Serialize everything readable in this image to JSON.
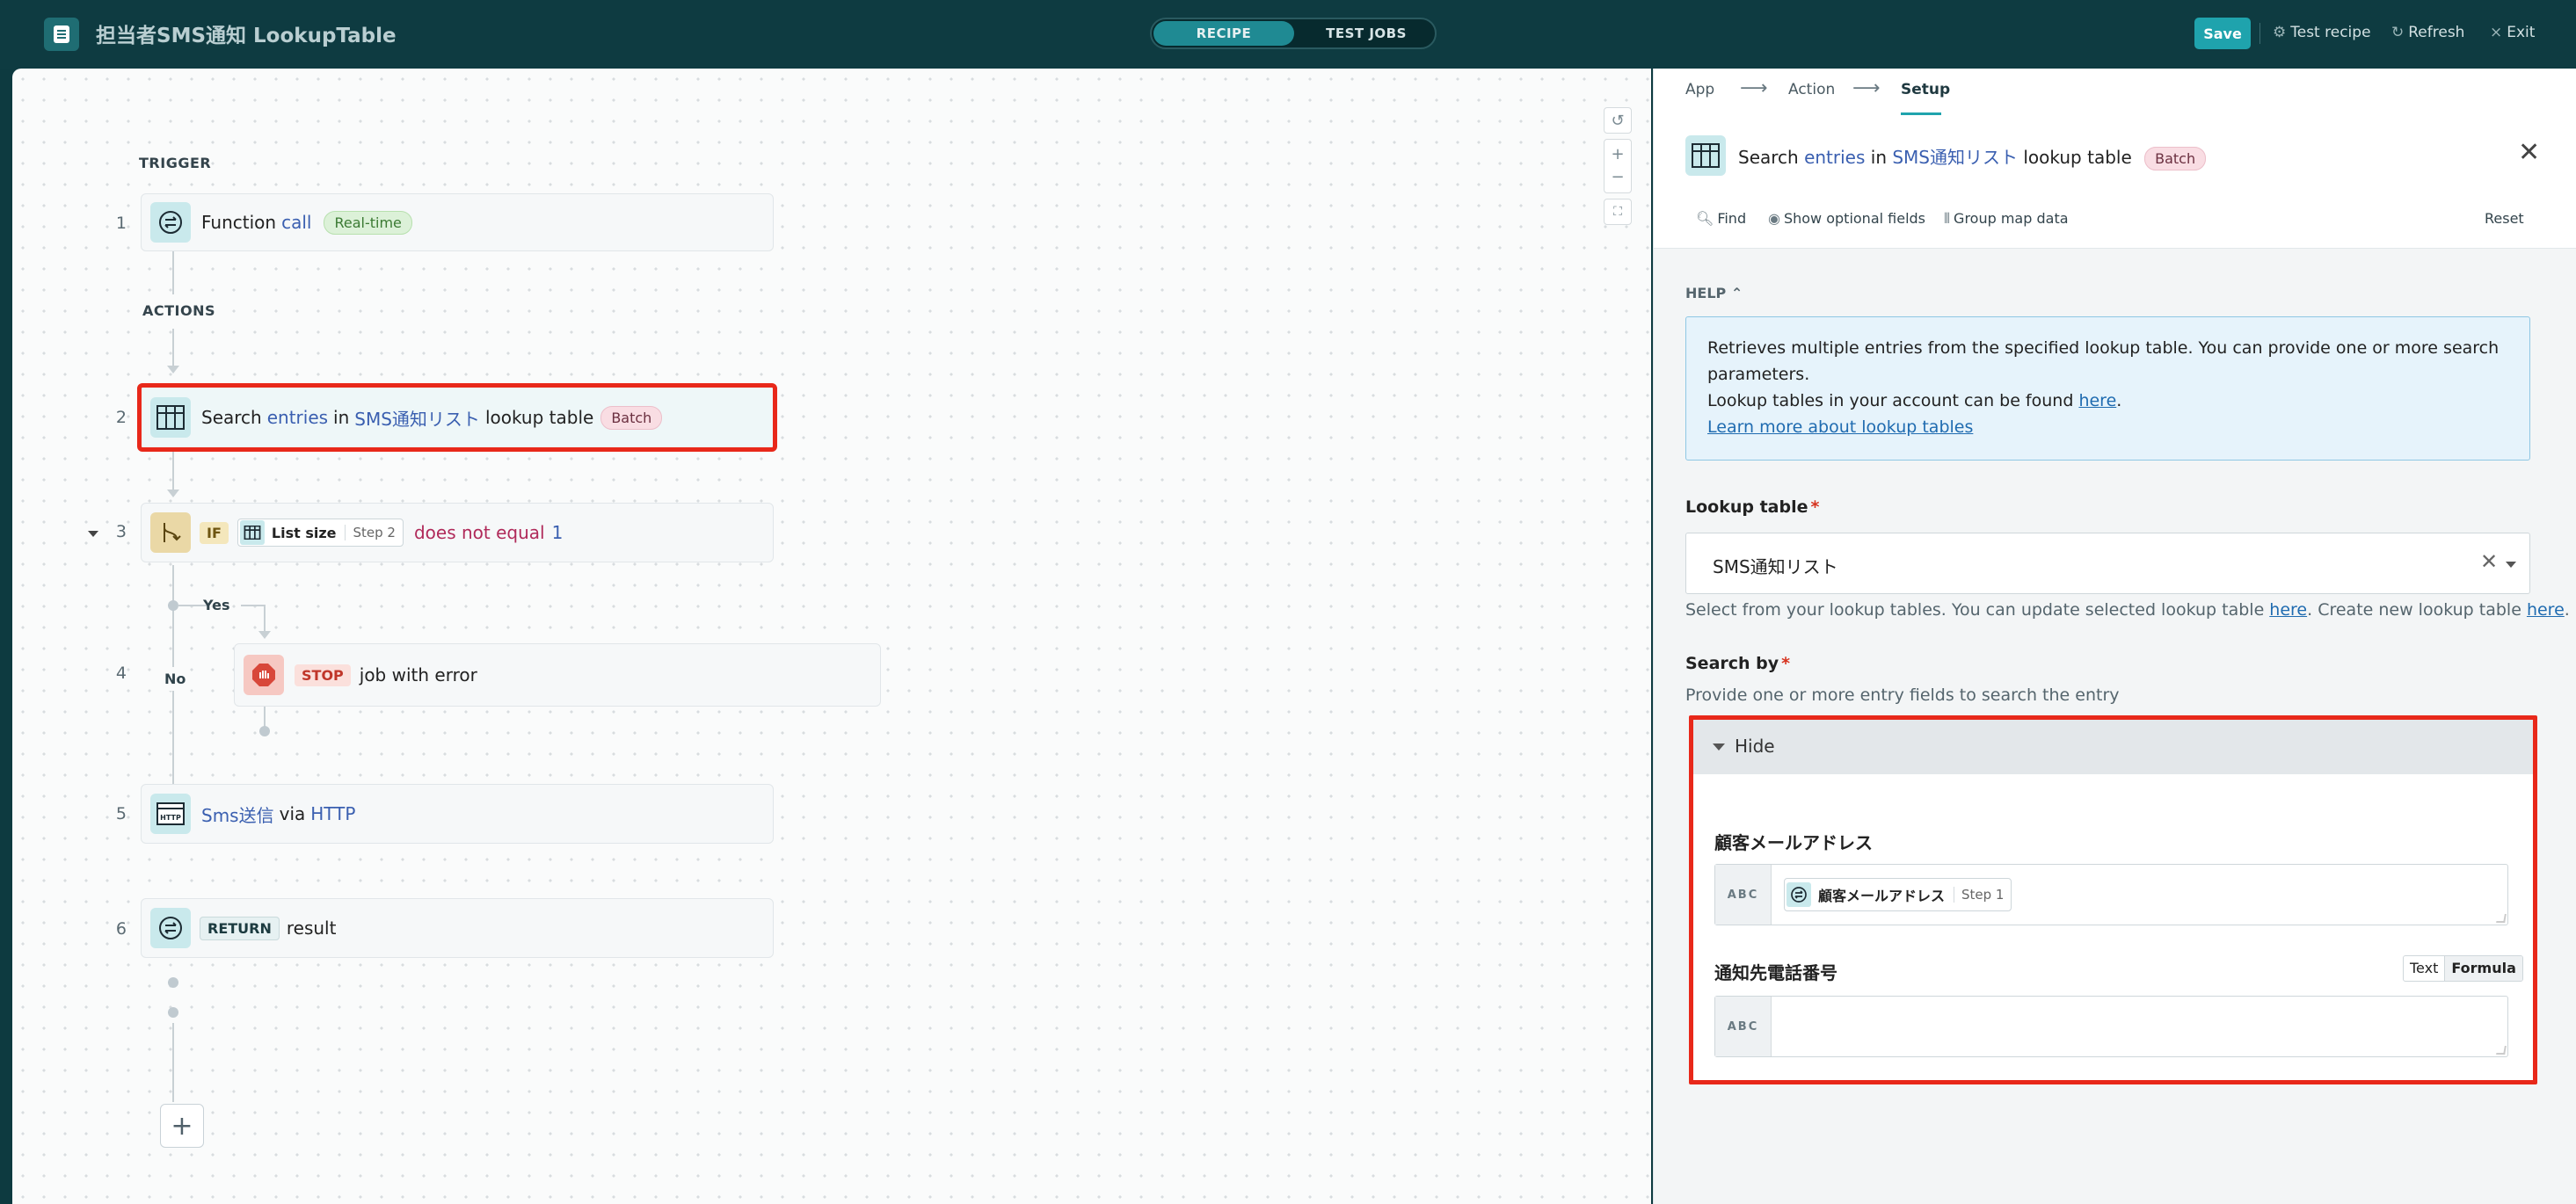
{
  "topbar": {
    "title": "担当者SMS通知 LookupTable",
    "tabs": [
      "RECIPE",
      "TEST JOBS"
    ],
    "save": "Save",
    "test_recipe": "Test recipe",
    "refresh": "Refresh",
    "exit": "Exit"
  },
  "canvas": {
    "trigger_label": "TRIGGER",
    "actions_label": "ACTIONS",
    "steps": {
      "s1": {
        "num": "1",
        "word": "Function",
        "link": "call",
        "badge": "Real-time"
      },
      "s2": {
        "num": "2",
        "word": "Search",
        "link1": "entries",
        "mid": "in",
        "link2": "SMS通知リスト",
        "tail": "lookup table",
        "badge": "Batch"
      },
      "s3": {
        "num": "3",
        "tag": "IF",
        "pill_name": "List size",
        "pill_step": "Step 2",
        "cond": "does not equal",
        "value": "1"
      },
      "s4": {
        "num": "4",
        "tag": "STOP",
        "text": "job with error"
      },
      "s5": {
        "num": "5",
        "link1": "Sms送信",
        "mid": "via",
        "link2": "HTTP"
      },
      "s6": {
        "num": "6",
        "tag": "RETURN",
        "text": "result"
      }
    },
    "branch_yes": "Yes",
    "branch_no": "No",
    "add_button": "+"
  },
  "panel": {
    "crumbs": [
      "App",
      "Action",
      "Setup"
    ],
    "header": {
      "word": "Search",
      "link1": "entries",
      "mid": "in",
      "link2": "SMS通知リスト",
      "tail": "lookup table",
      "badge": "Batch"
    },
    "tools": {
      "find": "Find",
      "optional": "Show optional fields",
      "group": "Group map data",
      "reset": "Reset"
    },
    "help": {
      "heading": "HELP",
      "line1": "Retrieves multiple entries from the specified lookup table. You can provide one or more search",
      "line2": "parameters.",
      "line3_pre": "Lookup tables in your account can be found ",
      "line3_link": "here",
      "line3_post": ".",
      "learn_more": "Learn more about lookup tables"
    },
    "lookup_table": {
      "label": "Lookup table",
      "required": "*",
      "value": "SMS通知リスト",
      "hint_pre": "Select from your lookup tables. You can update selected lookup table ",
      "hint_link1": "here",
      "hint_mid": ". Create new lookup table ",
      "hint_link2": "here",
      "hint_post": "."
    },
    "search_by": {
      "label": "Search by",
      "required": "*",
      "hint": "Provide one or more entry fields to search the entry",
      "toggle": "Hide",
      "field1": {
        "label": "顧客メールアドレス",
        "type": "ABC",
        "pill_name": "顧客メールアドレス",
        "pill_step": "Step 1"
      },
      "field2": {
        "label": "通知先電話番号",
        "type": "ABC",
        "mode_text": "Text",
        "mode_formula": "Formula"
      }
    }
  }
}
